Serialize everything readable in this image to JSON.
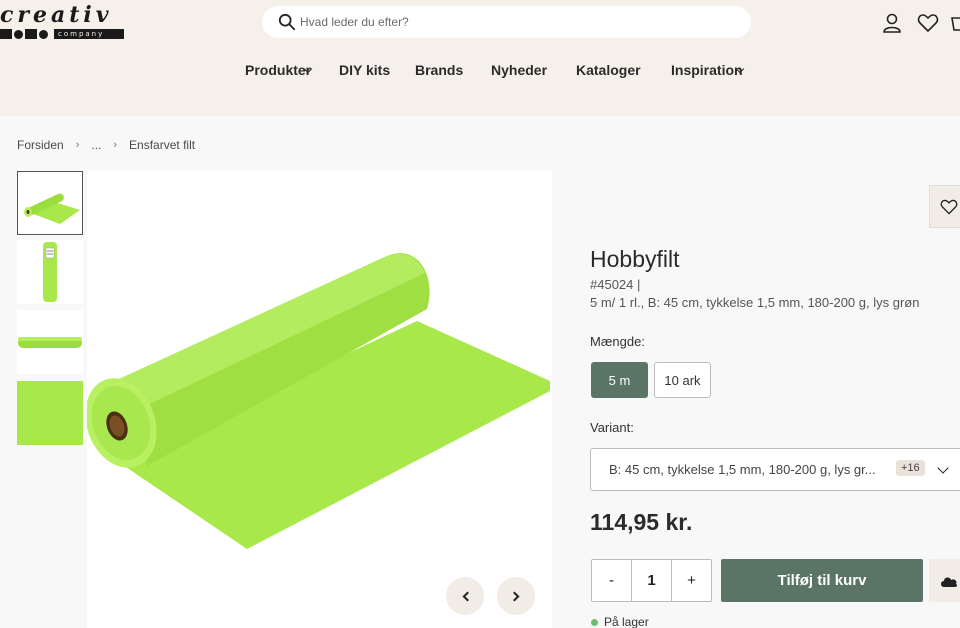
{
  "header": {
    "logo": {
      "word": "creativ",
      "sub": "company"
    },
    "search": {
      "placeholder": "Hvad leder du efter?"
    },
    "icons": [
      "search-icon",
      "user-icon",
      "heart-icon",
      "cart-icon"
    ]
  },
  "nav": {
    "items": [
      {
        "label": "Produkter"
      },
      {
        "label": "DIY kits"
      },
      {
        "label": "Brands"
      },
      {
        "label": "Nyheder"
      },
      {
        "label": "Kataloger"
      },
      {
        "label": "Inspiration"
      }
    ]
  },
  "breadcrumb": {
    "items": [
      "Forsiden",
      "...",
      "Ensfarvet filt"
    ]
  },
  "gallery": {
    "thumbnails": [
      "felt-roll",
      "felt-roll-packaged",
      "felt-roll-side",
      "felt-swatch"
    ],
    "prev_icon": "chevron-left-icon",
    "next_icon": "chevron-right-icon"
  },
  "product": {
    "title": "Hobbyfilt",
    "sku": "#45024 |",
    "description": "5 m/ 1 rl., B: 45 cm, tykkelse 1,5 mm, 180-200 g, lys grøn",
    "quantity_label": "Mængde:",
    "quantity_options": [
      "5 m",
      "10 ark"
    ],
    "variant_label": "Variant:",
    "variant_value": "B: 45 cm, tykkelse 1,5 mm, 180-200 g, lys gr...",
    "variant_more": "+16",
    "price": "114,95 kr.",
    "qty_minus": "-",
    "qty_value": "1",
    "qty_plus": "+",
    "add_to_cart": "Tilføj til kurv",
    "stock": "På lager"
  },
  "colors": {
    "header_bg": "#f5f0e9",
    "accent": "#5a7566",
    "felt": "#a8e84a",
    "stock_green": "#6bbf6b"
  }
}
